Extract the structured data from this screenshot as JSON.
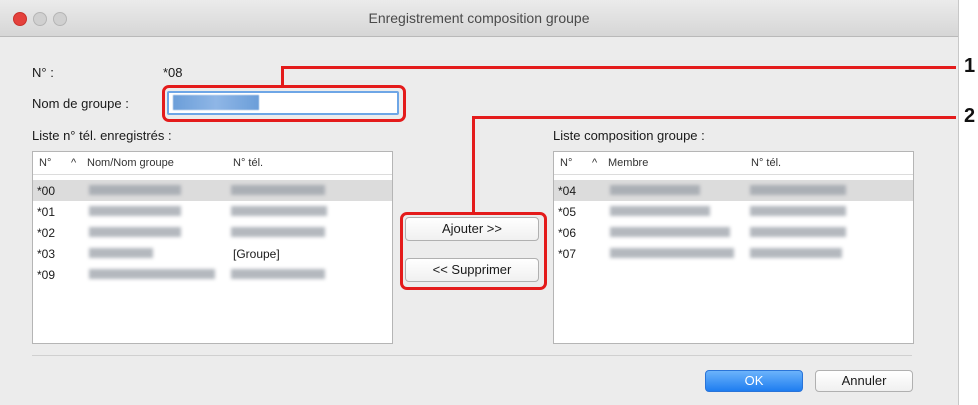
{
  "window": {
    "title": "Enregistrement composition groupe"
  },
  "form": {
    "number_label": "N° :",
    "number_value": "*08",
    "group_name_label": "Nom de groupe :"
  },
  "left_list": {
    "label": "Liste n° tél. enregistrés :",
    "columns": [
      "N°",
      "Nom/Nom groupe",
      "N° tél."
    ],
    "sort_indicator": "^",
    "rows": [
      {
        "num": "*00",
        "tel": ""
      },
      {
        "num": "*01",
        "tel": ""
      },
      {
        "num": "*02",
        "tel": ""
      },
      {
        "num": "*03",
        "tel": "[Groupe]"
      },
      {
        "num": "*09",
        "tel": ""
      }
    ]
  },
  "right_list": {
    "label": "Liste composition groupe :",
    "columns": [
      "N°",
      "Membre",
      "N° tél."
    ],
    "sort_indicator": "^",
    "rows": [
      {
        "num": "*04"
      },
      {
        "num": "*05"
      },
      {
        "num": "*06"
      },
      {
        "num": "*07"
      }
    ]
  },
  "buttons": {
    "add": "Ajouter >>",
    "remove": "<< Supprimer",
    "ok": "OK",
    "cancel": "Annuler"
  },
  "callouts": [
    "1",
    "2"
  ],
  "colors": {
    "callout": "#e41b1b",
    "primary_button": "#1e7df0",
    "focus_ring": "#6ea6e6"
  }
}
